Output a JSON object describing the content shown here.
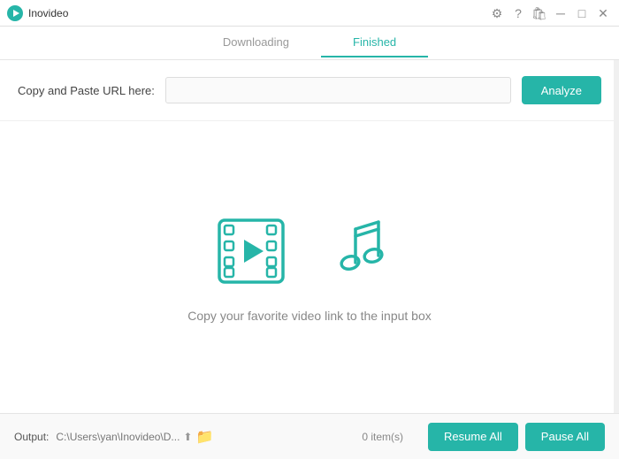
{
  "window": {
    "title": "Inovideo"
  },
  "titlebar": {
    "controls": [
      "⚙",
      "?",
      "🛒",
      "−",
      "□",
      "✕"
    ]
  },
  "tabs": [
    {
      "id": "downloading",
      "label": "Downloading",
      "active": false
    },
    {
      "id": "finished",
      "label": "Finished",
      "active": true
    }
  ],
  "url_area": {
    "label": "Copy and Paste URL here:",
    "input_placeholder": "",
    "analyze_button": "Analyze"
  },
  "illustration": {
    "text": "Copy your favorite video link to the input box"
  },
  "bottom_bar": {
    "output_label": "Output:",
    "output_path": "C:\\Users\\yan\\Inovideo\\D...",
    "items_count": "0 item(s)",
    "resume_button": "Resume All",
    "pause_button": "Pause All"
  }
}
